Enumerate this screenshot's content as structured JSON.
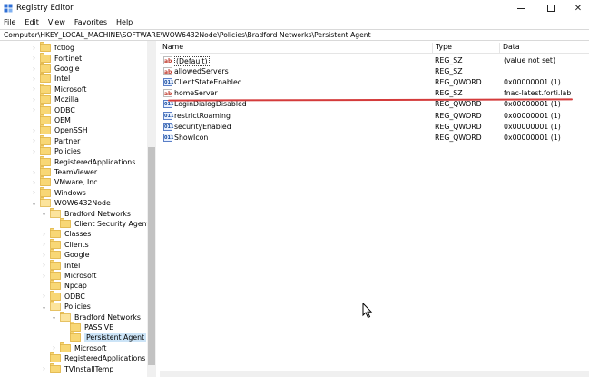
{
  "window": {
    "title": "Registry Editor",
    "controls": {
      "minimize": "minimize",
      "maximize": "maximize",
      "close": "✕"
    }
  },
  "menu": [
    "File",
    "Edit",
    "View",
    "Favorites",
    "Help"
  ],
  "address": "Computer\\HKEY_LOCAL_MACHINE\\SOFTWARE\\WOW6432Node\\Policies\\Bradford Networks\\Persistent Agent",
  "tree": [
    {
      "label": "fctlog",
      "indent": 0,
      "expander": "collapsed"
    },
    {
      "label": "Fortinet",
      "indent": 0,
      "expander": "collapsed"
    },
    {
      "label": "Google",
      "indent": 0,
      "expander": "collapsed"
    },
    {
      "label": "Intel",
      "indent": 0,
      "expander": "collapsed"
    },
    {
      "label": "Microsoft",
      "indent": 0,
      "expander": "collapsed"
    },
    {
      "label": "Mozilla",
      "indent": 0,
      "expander": "collapsed"
    },
    {
      "label": "ODBC",
      "indent": 0,
      "expander": "collapsed"
    },
    {
      "label": "OEM",
      "indent": 0,
      "expander": "none"
    },
    {
      "label": "OpenSSH",
      "indent": 0,
      "expander": "collapsed"
    },
    {
      "label": "Partner",
      "indent": 0,
      "expander": "collapsed"
    },
    {
      "label": "Policies",
      "indent": 0,
      "expander": "collapsed"
    },
    {
      "label": "RegisteredApplications",
      "indent": 0,
      "expander": "none"
    },
    {
      "label": "TeamViewer",
      "indent": 0,
      "expander": "collapsed"
    },
    {
      "label": "VMware, Inc.",
      "indent": 0,
      "expander": "collapsed"
    },
    {
      "label": "Windows",
      "indent": 0,
      "expander": "collapsed"
    },
    {
      "label": "WOW6432Node",
      "indent": 0,
      "expander": "expanded"
    },
    {
      "label": "Bradford Networks",
      "indent": 1,
      "expander": "expanded"
    },
    {
      "label": "Client Security Agent",
      "indent": 2,
      "expander": "none"
    },
    {
      "label": "Classes",
      "indent": 1,
      "expander": "collapsed"
    },
    {
      "label": "Clients",
      "indent": 1,
      "expander": "collapsed"
    },
    {
      "label": "Google",
      "indent": 1,
      "expander": "collapsed"
    },
    {
      "label": "Intel",
      "indent": 1,
      "expander": "collapsed"
    },
    {
      "label": "Microsoft",
      "indent": 1,
      "expander": "collapsed"
    },
    {
      "label": "Npcap",
      "indent": 1,
      "expander": "none"
    },
    {
      "label": "ODBC",
      "indent": 1,
      "expander": "collapsed"
    },
    {
      "label": "Policies",
      "indent": 1,
      "expander": "expanded"
    },
    {
      "label": "Bradford Networks",
      "indent": 2,
      "expander": "expanded"
    },
    {
      "label": "PASSIVE",
      "indent": 3,
      "expander": "none"
    },
    {
      "label": "Persistent Agent",
      "indent": 3,
      "expander": "none",
      "selected": true
    },
    {
      "label": "Microsoft",
      "indent": 2,
      "expander": "collapsed"
    },
    {
      "label": "RegisteredApplications",
      "indent": 1,
      "expander": "none"
    },
    {
      "label": "TVInstallTemp",
      "indent": 1,
      "expander": "collapsed"
    }
  ],
  "columns": {
    "name": "Name",
    "type": "Type",
    "data": "Data"
  },
  "values": [
    {
      "name": "(Default)",
      "type": "REG_SZ",
      "data": "(value not set)",
      "icon": "string-value-icon",
      "focused": true
    },
    {
      "name": "allowedServers",
      "type": "REG_SZ",
      "data": "",
      "icon": "string-value-icon"
    },
    {
      "name": "ClientStateEnabled",
      "type": "REG_QWORD",
      "data": "0x00000001 (1)",
      "icon": "binary-value-icon"
    },
    {
      "name": "homeServer",
      "type": "REG_SZ",
      "data": "fnac-latest.forti.lab",
      "icon": "string-value-icon"
    },
    {
      "name": "LoginDialogDisabled",
      "type": "REG_QWORD",
      "data": "0x00000001 (1)",
      "icon": "binary-value-icon"
    },
    {
      "name": "restrictRoaming",
      "type": "REG_QWORD",
      "data": "0x00000001 (1)",
      "icon": "binary-value-icon"
    },
    {
      "name": "securityEnabled",
      "type": "REG_QWORD",
      "data": "0x00000001 (1)",
      "icon": "binary-value-icon"
    },
    {
      "name": "ShowIcon",
      "type": "REG_QWORD",
      "data": "0x00000001 (1)",
      "icon": "binary-value-icon"
    }
  ],
  "icon_glyphs": {
    "string": "ab",
    "binary": "011"
  },
  "colors": {
    "selection": "#cce4f7",
    "folder": "#f8d775",
    "annotation_line": "#d43b3b"
  }
}
